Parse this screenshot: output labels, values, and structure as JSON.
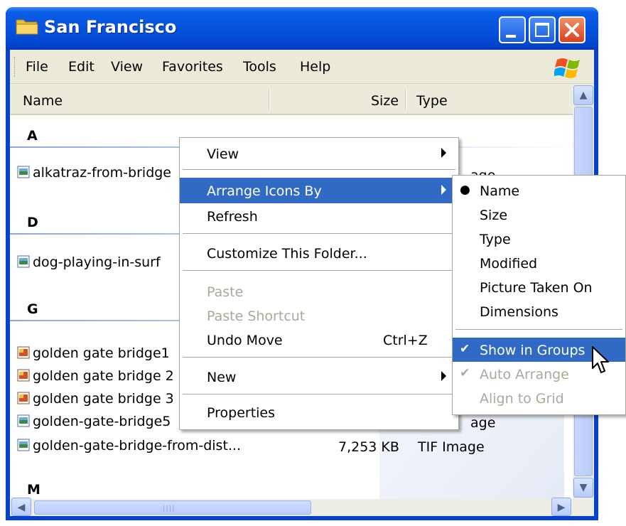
{
  "window": {
    "title": "San Francisco"
  },
  "menubar": {
    "items": [
      "File",
      "Edit",
      "View",
      "Favorites",
      "Tools",
      "Help"
    ]
  },
  "columns": {
    "name": "Name",
    "size": "Size",
    "type": "Type"
  },
  "groups": [
    {
      "letter": "A",
      "files": [
        {
          "name": "alkatraz-from-bridge",
          "type_tail": "age",
          "icon": "image-file-icon"
        }
      ]
    },
    {
      "letter": "D",
      "files": [
        {
          "name": "dog-playing-in-surf",
          "icon": "image-file-icon"
        }
      ]
    },
    {
      "letter": "G",
      "files": [
        {
          "name": "golden gate bridge1",
          "icon": "bmp-file-icon"
        },
        {
          "name": "golden gate bridge 2",
          "icon": "bmp-file-icon"
        },
        {
          "name": "golden gate bridge 3",
          "icon": "bmp-file-icon"
        },
        {
          "name": "golden-gate-bridge5",
          "type_tail": "age",
          "icon": "image-file-icon"
        },
        {
          "name": "golden-gate-bridge-from-dist...",
          "size": "7,253 KB",
          "type": "TIF Image",
          "icon": "image-file-icon"
        }
      ]
    },
    {
      "letter": "M",
      "files": []
    }
  ],
  "context_menu": {
    "view": "View",
    "arrange_icons_by": "Arrange Icons By",
    "refresh": "Refresh",
    "customize": "Customize This Folder...",
    "paste": "Paste",
    "paste_shortcut": "Paste Shortcut",
    "undo_move": "Undo Move",
    "undo_shortcut": "Ctrl+Z",
    "new": "New",
    "properties": "Properties"
  },
  "submenu": {
    "name": "Name",
    "size": "Size",
    "type": "Type",
    "modified": "Modified",
    "picture_taken_on": "Picture Taken On",
    "dimensions": "Dimensions",
    "show_in_groups": "Show in Groups",
    "auto_arrange": "Auto Arrange",
    "align_to_grid": "Align to Grid",
    "selected_sort": "Name",
    "show_in_groups_checked": true,
    "auto_arrange_checked": true
  },
  "colors": {
    "title_bar": "#0653dd",
    "highlight": "#316ac5",
    "disabled_text": "#aca899"
  }
}
